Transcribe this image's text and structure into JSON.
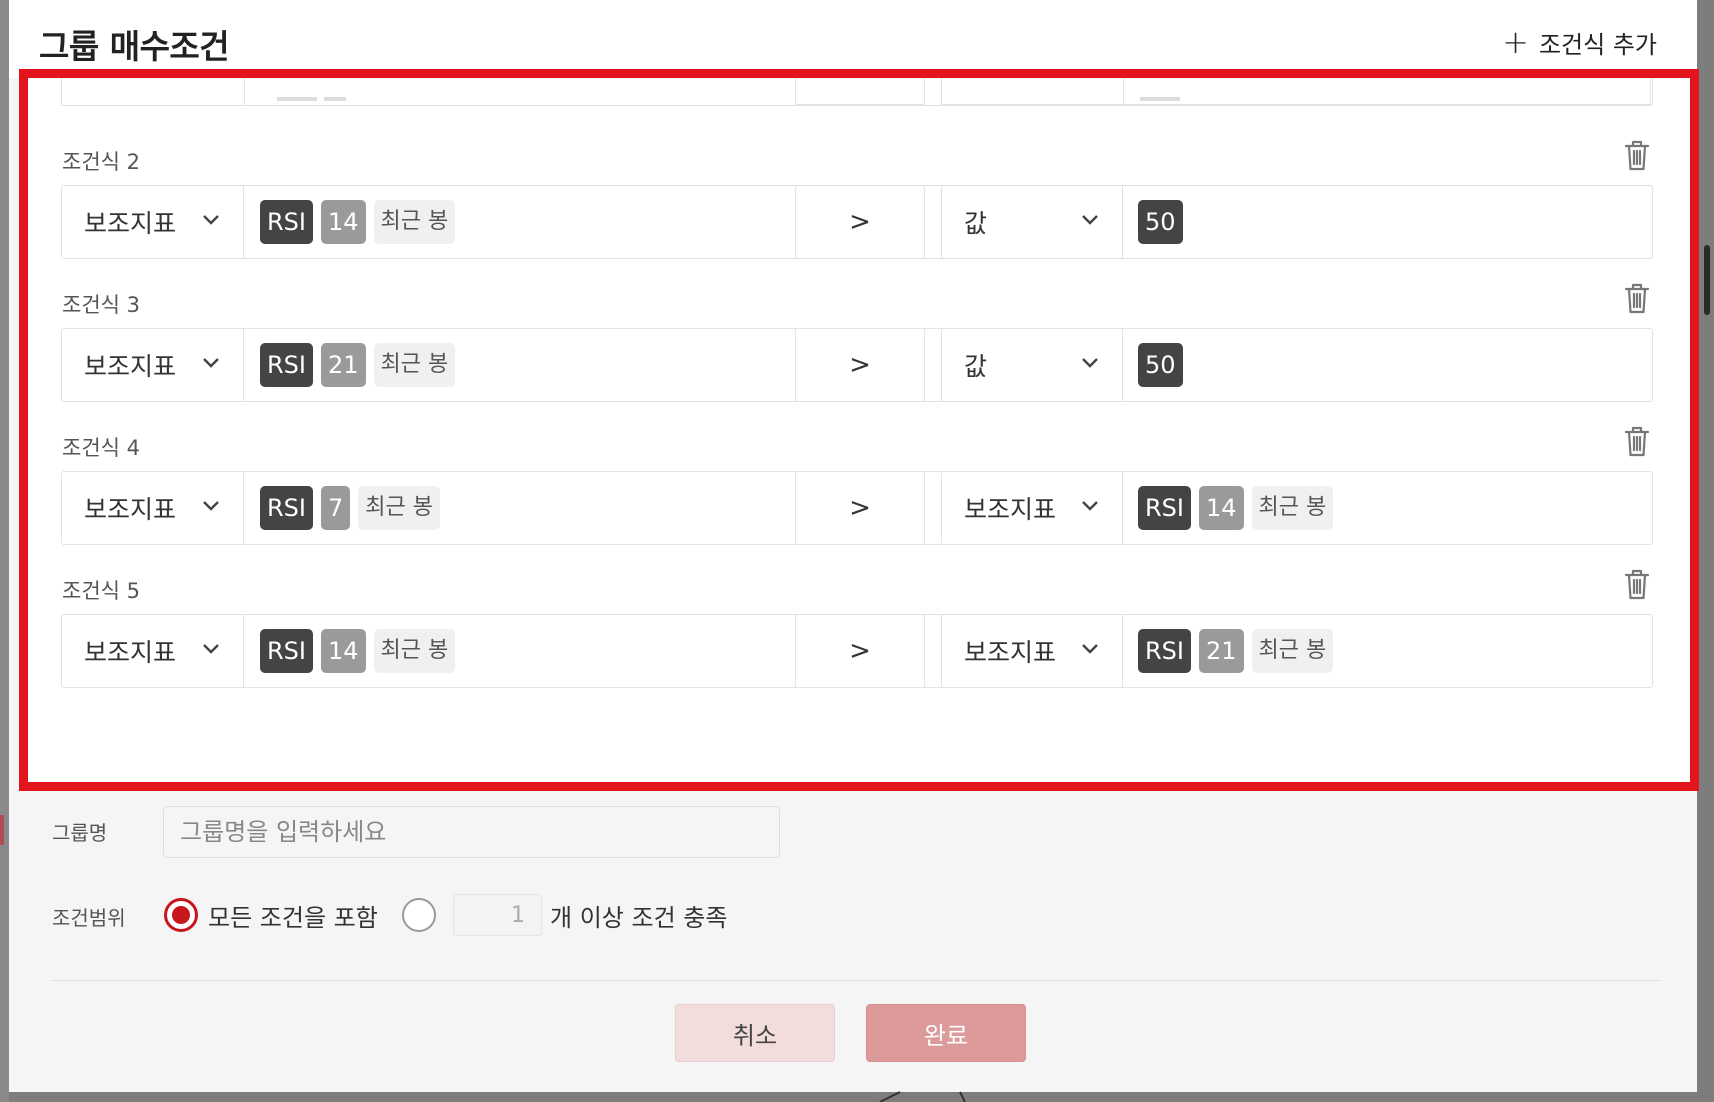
{
  "modal": {
    "title": "그룹 매수조건",
    "add_condition_label": "조건식 추가"
  },
  "conditions": [
    {
      "label": "조건식 2",
      "left_type": "보조지표",
      "left_chips": [
        "RSI",
        "14",
        "최근 봉"
      ],
      "operator": ">",
      "right_type": "값",
      "right_chips": [
        "50"
      ]
    },
    {
      "label": "조건식 3",
      "left_type": "보조지표",
      "left_chips": [
        "RSI",
        "21",
        "최근 봉"
      ],
      "operator": ">",
      "right_type": "값",
      "right_chips": [
        "50"
      ]
    },
    {
      "label": "조건식 4",
      "left_type": "보조지표",
      "left_chips": [
        "RSI",
        "7",
        "최근 봉"
      ],
      "operator": ">",
      "right_type": "보조지표",
      "right_chips": [
        "RSI",
        "14",
        "최근 봉"
      ]
    },
    {
      "label": "조건식 5",
      "left_type": "보조지표",
      "left_chips": [
        "RSI",
        "14",
        "최근 봉"
      ],
      "operator": ">",
      "right_type": "보조지표",
      "right_chips": [
        "RSI",
        "21",
        "최근 봉"
      ]
    }
  ],
  "group": {
    "name_label": "그룹명",
    "name_placeholder": "그룹명을 입력하세요",
    "scope_label": "조건범위",
    "scope_all_label": "모든 조건을 포함",
    "scope_count_value": "1",
    "scope_count_label": "개 이상 조건 충족"
  },
  "buttons": {
    "cancel": "취소",
    "ok": "완료"
  },
  "colors": {
    "accent": "#c8161d",
    "highlight_border": "#e3141b",
    "chip_dark": "#444444",
    "chip_gray": "#9a9a9a"
  }
}
